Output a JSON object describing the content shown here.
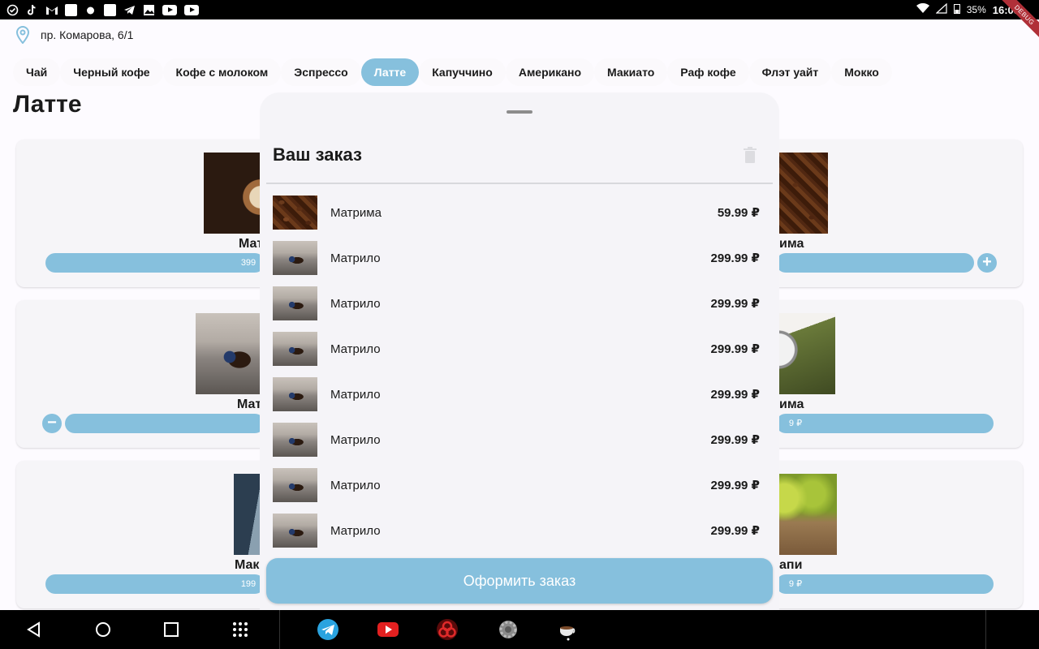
{
  "status_bar": {
    "time": "16:05",
    "battery": "35%",
    "debug_label": "DEBUG",
    "notification_icons": [
      "check-circle-icon",
      "tiktok-icon",
      "gmail-icon",
      "square-icon",
      "app-icon",
      "square-icon",
      "telegram-icon",
      "image-icon",
      "youtube-icon",
      "youtube-icon"
    ]
  },
  "address": "пр. Комарова, 6/1",
  "categories": [
    "Чай",
    "Черный кофе",
    "Кофе с молоком",
    "Эспрессо",
    "Латте",
    "Капуччино",
    "Американо",
    "Макиато",
    "Раф кофе",
    "Флэт уайт",
    "Мокко"
  ],
  "active_category": "Латте",
  "page_title": "Латте",
  "background_products": {
    "row1_left_name": "Мат",
    "row1_left_price": "399",
    "row1_right_name": "има",
    "row2_left_name": "Мат",
    "row2_right_name": "има",
    "row2_right_price": "9 ₽",
    "row3_left_name": "Мак",
    "row3_left_price": "199",
    "row3_right_name": "апи",
    "row3_right_price": "9 ₽"
  },
  "sheet": {
    "title": "Ваш заказ",
    "items": [
      {
        "name": "Матрима",
        "price": "59.99 ₽",
        "image": "beans"
      },
      {
        "name": "Матрило",
        "price": "299.99 ₽",
        "image": "mini"
      },
      {
        "name": "Матрило",
        "price": "299.99 ₽",
        "image": "mini"
      },
      {
        "name": "Матрило",
        "price": "299.99 ₽",
        "image": "mini"
      },
      {
        "name": "Матрило",
        "price": "299.99 ₽",
        "image": "mini"
      },
      {
        "name": "Матрило",
        "price": "299.99 ₽",
        "image": "mini"
      },
      {
        "name": "Матрило",
        "price": "299.99 ₽",
        "image": "mini"
      },
      {
        "name": "Матрило",
        "price": "299.99 ₽",
        "image": "mini"
      }
    ],
    "checkout_label": "Оформить заказ"
  },
  "colors": {
    "accent": "#86c0dd",
    "background": "#fdfbff",
    "sheet": "#f5f4f8"
  },
  "navbar": {
    "system_buttons": [
      "back-icon",
      "home-icon",
      "recents-icon",
      "apps-grid-icon"
    ],
    "dock_apps": [
      "telegram-icon",
      "youtube-icon",
      "biohazard-icon",
      "settings-icon",
      "coffee-cup-icon"
    ]
  }
}
